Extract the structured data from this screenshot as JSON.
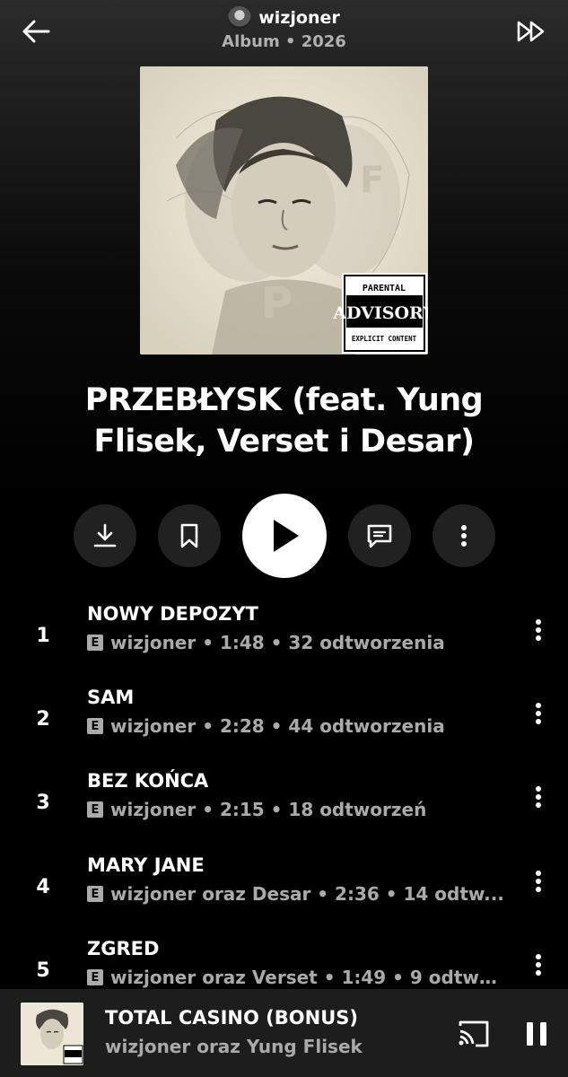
{
  "header": {
    "artist": "wizjoner",
    "subtitle": "Album • 2026",
    "back_icon": "arrow-left-icon",
    "skip_icon": "fast-forward-icon"
  },
  "album": {
    "title": "PRZEBŁYSK (feat. Yung Flisek, Verset i Desar)",
    "cover_badge": {
      "line1": "PARENTAL",
      "line2": "ADVISORY",
      "line3": "EXPLICIT CONTENT"
    }
  },
  "actions": {
    "download_icon": "download-icon",
    "save_icon": "bookmark-icon",
    "play_icon": "play-icon",
    "comments_icon": "comment-icon",
    "more_icon": "more-vertical-icon"
  },
  "tracks": [
    {
      "number": "1",
      "title": "NOWY DEPOZYT",
      "explicit": "E",
      "meta": "wizjoner • 1:48 • 32 odtworzenia"
    },
    {
      "number": "2",
      "title": "SAM",
      "explicit": "E",
      "meta": "wizjoner • 2:28 • 44 odtworzenia"
    },
    {
      "number": "3",
      "title": "BEZ KOŃCA",
      "explicit": "E",
      "meta": "wizjoner • 2:15 • 18 odtworzeń"
    },
    {
      "number": "4",
      "title": "MARY JANE",
      "explicit": "E",
      "meta": "wizjoner oraz Desar • 2:36 • 14 odtw..."
    },
    {
      "number": "5",
      "title": "ZGRED",
      "explicit": "E",
      "meta": "wizjoner oraz Verset • 1:49 • 9 odtwo..."
    }
  ],
  "now_playing": {
    "title": "TOTAL CASINO (BONUS)",
    "artist": "wizjoner oraz Yung Flisek",
    "cast_icon": "cast-icon",
    "pause_icon": "pause-icon"
  },
  "colors": {
    "background": "#000000",
    "secondary_text": "#aaaaaa",
    "button_bg": "#212121",
    "miniplayer_bg": "#1d1d1d"
  }
}
